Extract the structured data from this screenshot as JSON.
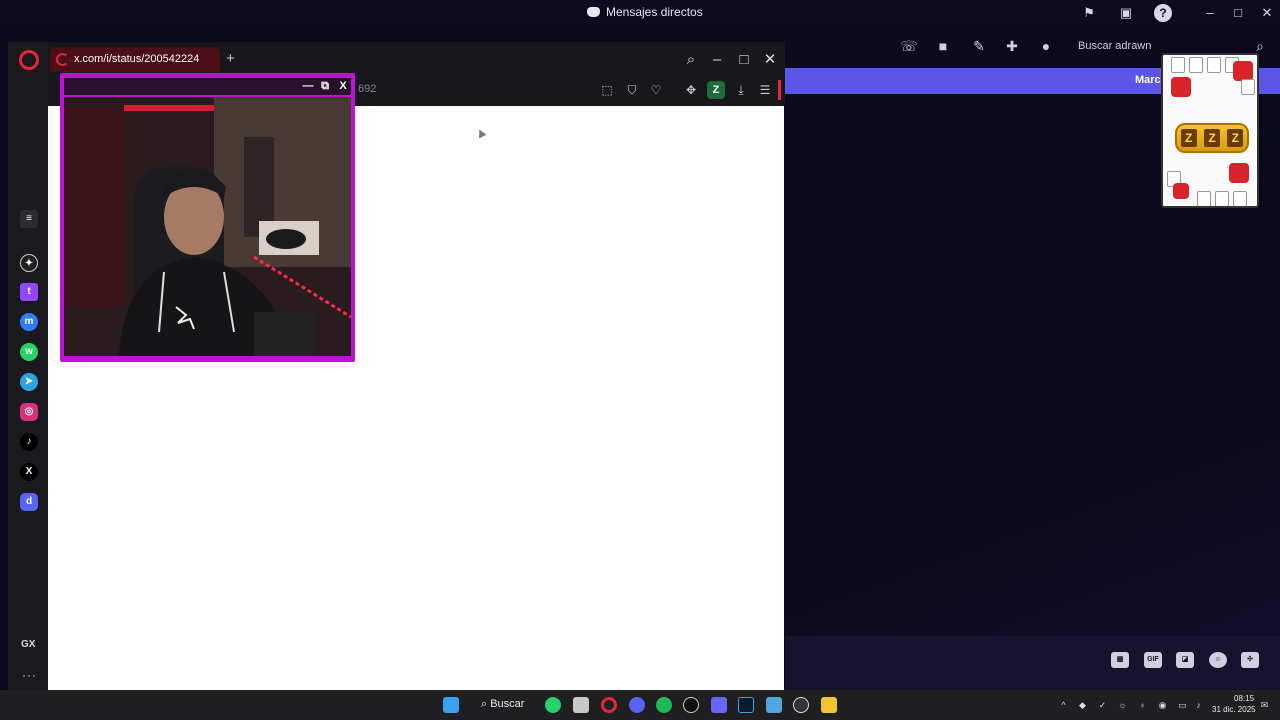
{
  "discord": {
    "window_title": "Mensajes directos",
    "search_label": "Buscar adrawn",
    "banner_label": "Marca",
    "colors": {
      "banner": "#5b56e8",
      "background": "#0b0a1c"
    },
    "toolbar_icons": [
      "phone-icon",
      "video-icon",
      "pin-icon",
      "add-friend-icon",
      "profile-icon"
    ],
    "composer_icons": [
      "gift-icon",
      "gif-icon",
      "sticker-icon",
      "emoji-icon",
      "apps-icon"
    ],
    "composer_gif_label": "GIF",
    "sticker": {
      "reels": [
        "Z",
        "Z",
        "Z"
      ]
    }
  },
  "browser": {
    "tab_title": "x.com/i/status/200542224",
    "address_fragment": "692",
    "extension_label": "Z",
    "sidebar_gx_label": "GX",
    "sidebar_more_label": "···",
    "sidebar_icons": [
      "chatgpt-icon",
      "twitch-icon",
      "messenger-icon",
      "whatsapp-icon",
      "telegram-icon",
      "instagram-icon",
      "tiktok-icon",
      "x-icon",
      "discord-icon"
    ],
    "sidebar_glyphs": [
      "✦",
      "t",
      "m",
      "w",
      "➤",
      "◎",
      "♪",
      "X",
      "d"
    ],
    "accent": "#e8243a"
  },
  "webcam": {
    "close_label": "X",
    "frame_color": "#c012d4"
  },
  "taskbar": {
    "search_label": "Buscar",
    "time": "08:15",
    "date": "31 dic. 2025"
  }
}
